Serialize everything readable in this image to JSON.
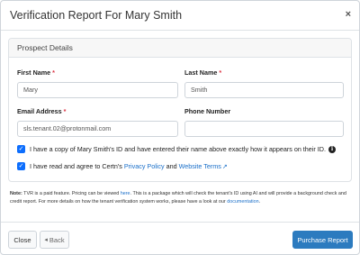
{
  "modal": {
    "title": "Verification Report For Mary Smith",
    "close_glyph": "×"
  },
  "card": {
    "title": "Prospect Details"
  },
  "form": {
    "first_name_label": "First Name",
    "first_name_value": "Mary",
    "last_name_label": "Last Name",
    "last_name_value": "Smith",
    "email_label": "Email Address",
    "email_value": "sls.tenant.02@protonmail.com",
    "phone_label": "Phone Number",
    "phone_value": "",
    "required_mark": "*"
  },
  "checks": {
    "id_text": "I have a copy of Mary Smith's ID and have entered their name above exactly how it appears on their ID.",
    "terms_prefix": "I have read and agree to Certn's ",
    "privacy_link": "Privacy Policy",
    "terms_and": " and ",
    "terms_link": "Website Terms",
    "check_glyph": "✓",
    "info_glyph": "i",
    "external_glyph": "↗"
  },
  "note": {
    "label": "Note:",
    "text1": " TVR is a paid feature. Pricing can be viewed ",
    "here_link": "here",
    "text2": ". This is a package which will check the tenant's ID using AI and will provide a background check and credit report. For more details on how the tenant verification system works, please have a look at our ",
    "doc_link": "documentation",
    "text3": "."
  },
  "footer": {
    "close_label": "Close",
    "back_label": "Back",
    "back_glyph": "◂",
    "purchase_label": "Purchase Report"
  },
  "colors": {
    "primary": "#2c7bbf",
    "checkbox": "#0d6efd",
    "required": "#dc3545",
    "link": "#1a6fc9"
  }
}
